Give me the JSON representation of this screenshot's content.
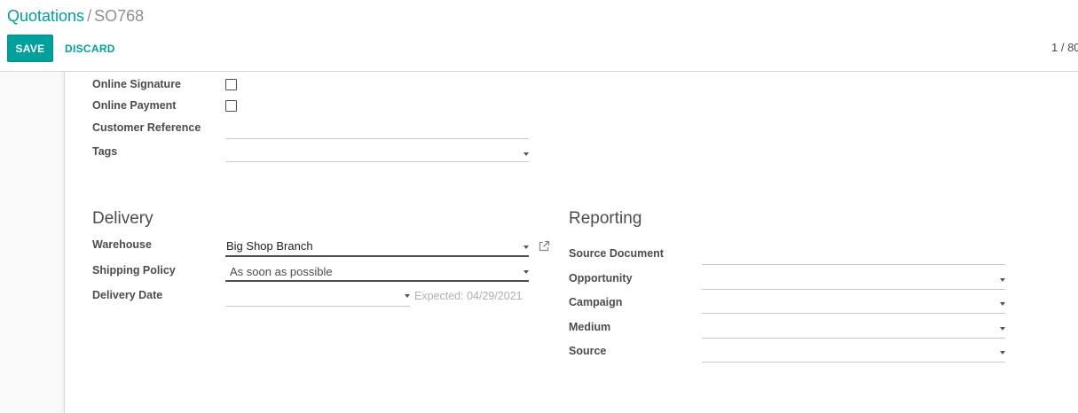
{
  "breadcrumb": {
    "parent": "Quotations",
    "separator": "/",
    "current": "SO768"
  },
  "toolbar": {
    "save_label": "SAVE",
    "discard_label": "DISCARD"
  },
  "pager": {
    "text": "1 / 80"
  },
  "options": {
    "online_signature_label": "Online Signature",
    "online_payment_label": "Online Payment",
    "customer_reference_label": "Customer Reference",
    "tags_label": "Tags"
  },
  "delivery": {
    "title": "Delivery",
    "warehouse_label": "Warehouse",
    "warehouse_value": "Big Shop Branch",
    "shipping_policy_label": "Shipping Policy",
    "shipping_policy_value": "As soon as possible",
    "delivery_date_label": "Delivery Date",
    "expected_text": "Expected: 04/29/2021"
  },
  "reporting": {
    "title": "Reporting",
    "source_document_label": "Source Document",
    "opportunity_label": "Opportunity",
    "campaign_label": "Campaign",
    "medium_label": "Medium",
    "source_label": "Source"
  },
  "colors": {
    "accent": "#00a09d",
    "text": "#4c4c4c"
  }
}
